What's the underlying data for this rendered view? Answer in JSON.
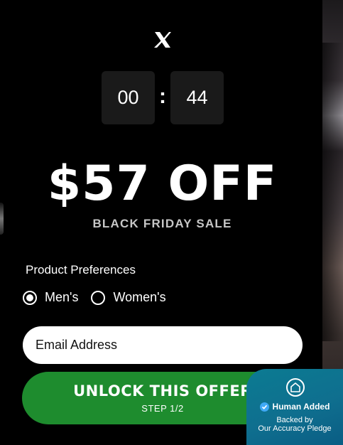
{
  "brand": {
    "logo_icon": "x-logo-icon"
  },
  "timer": {
    "minutes": "00",
    "separator": ":",
    "seconds": "44"
  },
  "offer": {
    "headline": "$57 OFF",
    "subheadline": "BLACK FRIDAY SALE"
  },
  "preferences": {
    "label": "Product Preferences",
    "options": [
      {
        "label": "Men's",
        "selected": true
      },
      {
        "label": "Women's",
        "selected": false
      }
    ]
  },
  "form": {
    "email_placeholder": "Email Address",
    "email_value": ""
  },
  "cta": {
    "label": "UNLOCK THIS OFFER",
    "step": "STEP 1/2",
    "color": "#1e8c2e"
  },
  "badge": {
    "icon": "shield-home-icon",
    "title": "Human Added",
    "line1": "Backed by",
    "line2": "Our Accuracy Pledge",
    "color": "#0f6f8f"
  }
}
